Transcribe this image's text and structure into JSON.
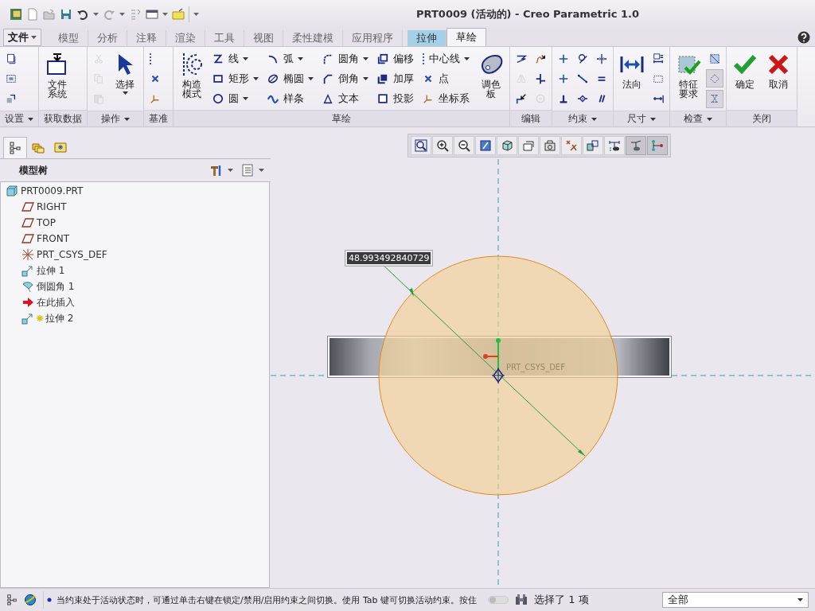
{
  "window": {
    "title": "PRT0009 (活动的) - Creo Parametric 1.0"
  },
  "tabs": [
    {
      "label": "文件",
      "kind": "menu",
      "selected": false
    },
    {
      "label": "模型",
      "kind": "tab",
      "selected": false
    },
    {
      "label": "分析",
      "kind": "tab",
      "selected": false
    },
    {
      "label": "注释",
      "kind": "tab",
      "selected": false
    },
    {
      "label": "渲染",
      "kind": "tab",
      "selected": false
    },
    {
      "label": "工具",
      "kind": "tab",
      "selected": false
    },
    {
      "label": "视图",
      "kind": "tab",
      "selected": false
    },
    {
      "label": "柔性建模",
      "kind": "tab",
      "selected": false
    },
    {
      "label": "应用程序",
      "kind": "tab",
      "selected": false
    },
    {
      "label": "拉伸",
      "kind": "context",
      "selected": false
    },
    {
      "label": "草绘",
      "kind": "tab",
      "selected": true
    }
  ],
  "ribbon": {
    "groups": [
      {
        "name": "设置",
        "menu": true,
        "items": [
          {
            "kind": "icon"
          },
          {
            "kind": "icon"
          },
          {
            "kind": "icon"
          }
        ]
      },
      {
        "name": "获取数据",
        "menu": false,
        "items": [
          {
            "kind": "large",
            "label": "文件系统",
            "dropdown": false
          }
        ]
      },
      {
        "name": "操作",
        "menu": true,
        "items": [
          {
            "kind": "icon",
            "disabled": true
          },
          {
            "kind": "icon",
            "disabled": true
          },
          {
            "kind": "icon",
            "disabled": true
          },
          {
            "kind": "large",
            "label": "选择",
            "dropdown": true,
            "disabled": false
          }
        ]
      },
      {
        "name": "基准",
        "menu": false,
        "items": [
          {
            "kind": "icon"
          },
          {
            "kind": "icon"
          },
          {
            "kind": "icon"
          }
        ]
      },
      {
        "name": "草绘",
        "menu": false,
        "items": [
          {
            "kind": "large",
            "label": "构造模式",
            "dropdown": false
          },
          {
            "kind": "small",
            "label": "线",
            "dropdown": true
          },
          {
            "kind": "small",
            "label": "矩形",
            "dropdown": true
          },
          {
            "kind": "small",
            "label": "圆",
            "dropdown": true
          },
          {
            "kind": "small",
            "label": "弧",
            "dropdown": true
          },
          {
            "kind": "small",
            "label": "椭圆",
            "dropdown": true
          },
          {
            "kind": "small",
            "label": "样条",
            "dropdown": false
          },
          {
            "kind": "small",
            "label": "圆角",
            "dropdown": true
          },
          {
            "kind": "small",
            "label": "倒角",
            "dropdown": true
          },
          {
            "kind": "small",
            "label": "文本",
            "dropdown": false
          },
          {
            "kind": "small",
            "label": "偏移",
            "dropdown": false
          },
          {
            "kind": "small",
            "label": "加厚",
            "dropdown": false
          },
          {
            "kind": "small",
            "label": "投影",
            "dropdown": false
          },
          {
            "kind": "small",
            "label": "中心线",
            "dropdown": true
          },
          {
            "kind": "small",
            "label": "点",
            "dropdown": false
          },
          {
            "kind": "small",
            "label": "坐标系",
            "dropdown": false
          },
          {
            "kind": "large",
            "label": "调色板",
            "dropdown": false
          }
        ]
      },
      {
        "name": "编辑",
        "menu": false,
        "items": [
          {
            "kind": "icon",
            "disabled": false
          },
          {
            "kind": "icon",
            "disabled": true
          },
          {
            "kind": "icon",
            "disabled": false
          },
          {
            "kind": "icon",
            "disabled": false
          },
          {
            "kind": "icon",
            "disabled": false
          },
          {
            "kind": "icon",
            "disabled": true
          }
        ]
      },
      {
        "name": "约束",
        "menu": true,
        "items": [
          {
            "kind": "icon"
          },
          {
            "kind": "icon"
          },
          {
            "kind": "icon"
          },
          {
            "kind": "icon"
          },
          {
            "kind": "icon"
          },
          {
            "kind": "icon"
          },
          {
            "kind": "icon"
          },
          {
            "kind": "icon"
          },
          {
            "kind": "icon"
          }
        ]
      },
      {
        "name": "尺寸",
        "menu": true,
        "items": [
          {
            "kind": "large",
            "label": "法向",
            "dropdown": false
          },
          {
            "kind": "icon"
          },
          {
            "kind": "icon"
          },
          {
            "kind": "icon"
          }
        ]
      },
      {
        "name": "检查",
        "menu": true,
        "items": [
          {
            "kind": "large",
            "label": "特征要求",
            "dropdown": false,
            "on": false
          },
          {
            "kind": "icon",
            "on": false
          },
          {
            "kind": "icon",
            "on": true
          },
          {
            "kind": "icon",
            "on": true
          }
        ]
      },
      {
        "name": "关闭",
        "menu": false,
        "items": [
          {
            "kind": "large",
            "label": "确定",
            "dropdown": false
          },
          {
            "kind": "large",
            "label": "取消",
            "dropdown": false
          }
        ]
      }
    ]
  },
  "navigator": {
    "tabs": [
      {
        "selected": true
      },
      {
        "selected": false
      },
      {
        "selected": false
      }
    ],
    "title": "模型树",
    "tree": [
      {
        "label": "PRT0009.PRT",
        "kind": "part",
        "children": [
          {
            "label": "RIGHT",
            "kind": "plane"
          },
          {
            "label": "TOP",
            "kind": "plane"
          },
          {
            "label": "FRONT",
            "kind": "plane"
          },
          {
            "label": "PRT_CSYS_DEF",
            "kind": "csys"
          },
          {
            "label": "拉伸 1",
            "kind": "extrude"
          },
          {
            "label": "倒圆角 1",
            "kind": "round"
          },
          {
            "label": "在此插入",
            "kind": "insert"
          },
          {
            "label": "拉伸 2",
            "kind": "extrude_new"
          }
        ]
      }
    ]
  },
  "graphics": {
    "view_toolbar": [
      {
        "on": false
      },
      {
        "on": false
      },
      {
        "on": false
      },
      {
        "on": false
      },
      {
        "on": false
      },
      {
        "on": false
      },
      {
        "on": false
      },
      {
        "on": false
      },
      {
        "on": false
      },
      {
        "on": false
      },
      {
        "on": true
      },
      {
        "on": true
      }
    ],
    "dimension_value": "48.993492840729",
    "csys_label": "PRT_CSYS_DEF"
  },
  "status_bar": {
    "message": "当约束处于活动状态时，可通过单击右键在锁定/禁用/启用约束之间切换。使用 Tab 键可切换活动约束。按住",
    "selection": "选择了 1 项",
    "filter": "全部"
  }
}
